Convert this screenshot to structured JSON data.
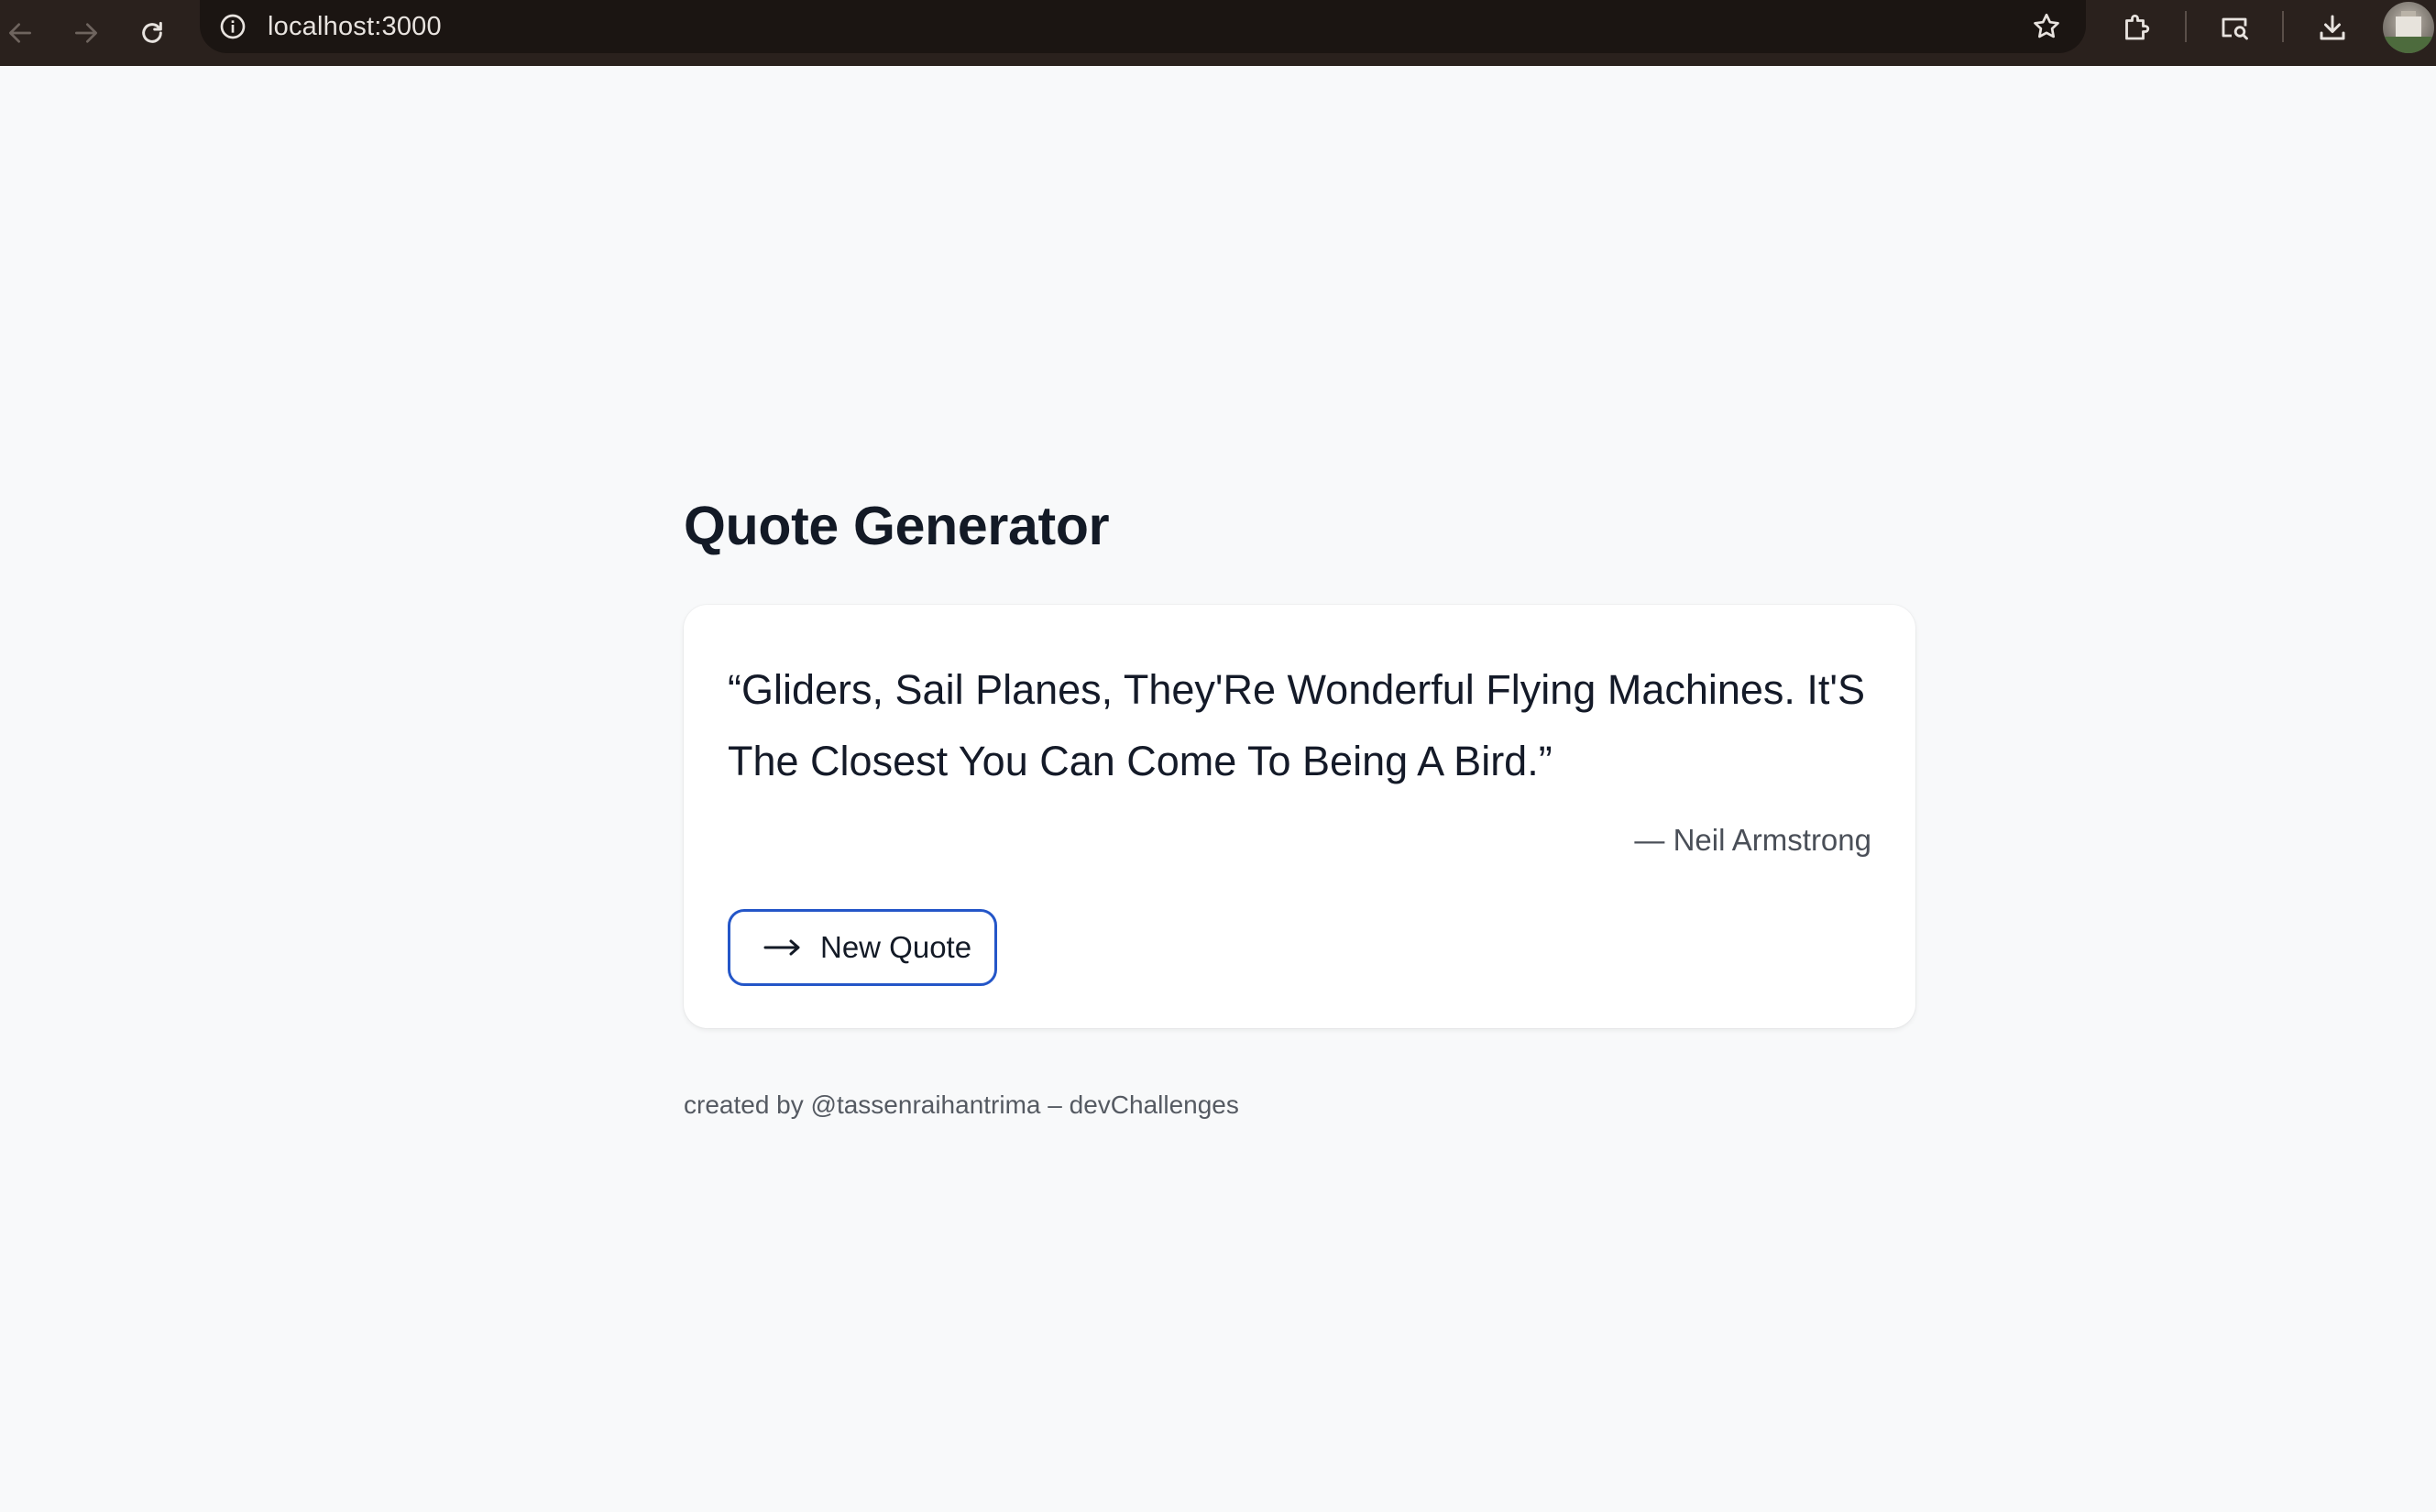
{
  "browser": {
    "url": "localhost:3000",
    "icons": [
      "back-arrow-icon",
      "forward-arrow-icon",
      "reload-icon",
      "info-icon",
      "bookmark-star-icon",
      "extensions-icon",
      "tab-search-icon",
      "download-icon",
      "profile-avatar"
    ]
  },
  "page": {
    "title": "Quote Generator"
  },
  "quote": {
    "text": "“Gliders, Sail Planes, They'Re Wonderful Flying Machines. It'S The Closest You Can Come To Being A Bird.”",
    "author": "— Neil Armstrong"
  },
  "button": {
    "new_quote_label": "New Quote",
    "icon": "arrow-right-icon",
    "border_color": "#2456c8"
  },
  "footer": {
    "text": "created by @tassenraihantrima – devChallenges"
  },
  "colors": {
    "page_background": "#f8f9fa",
    "chrome_background": "#2a211d",
    "text_primary": "#131a26"
  }
}
